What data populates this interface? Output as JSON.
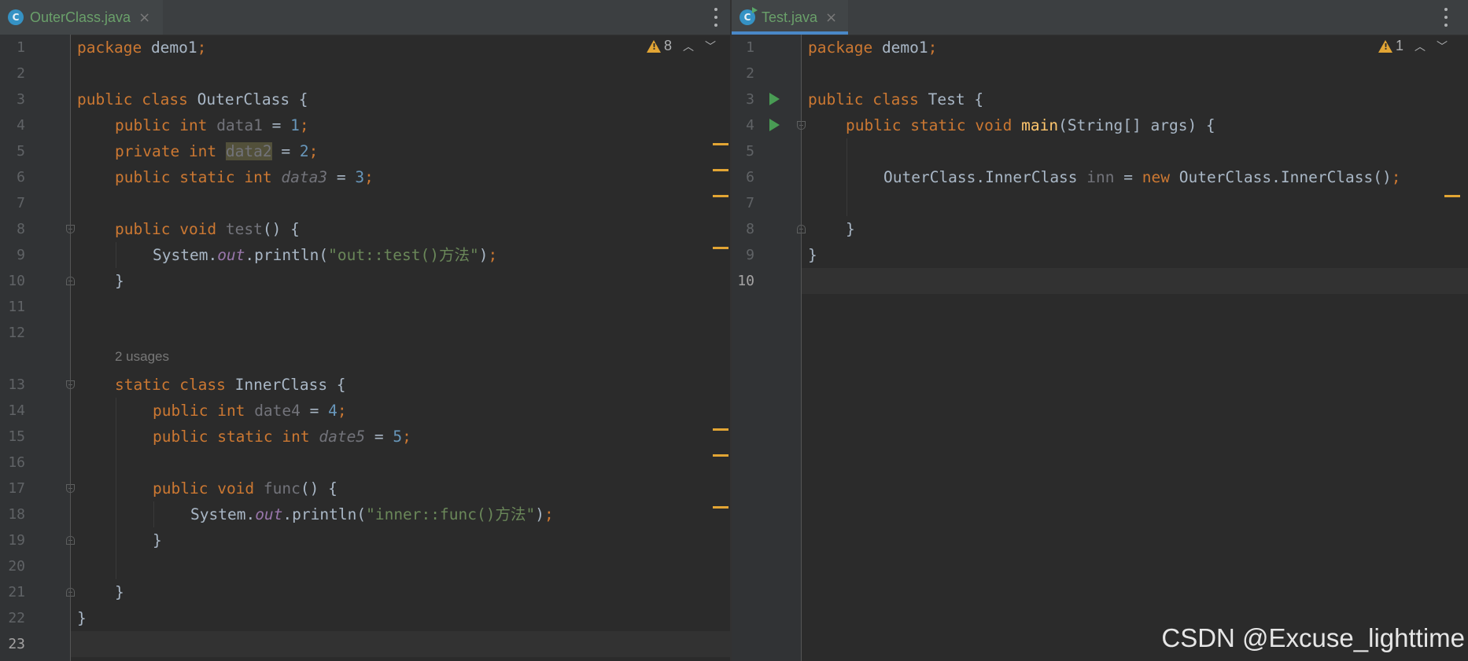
{
  "left": {
    "tab": {
      "icon": "class-icon",
      "icon_letter": "C",
      "title": "OuterClass.java",
      "close": "×"
    },
    "inspection": {
      "icon": "warning-triangle-icon",
      "count": "8"
    },
    "line_numbers": [
      "1",
      "2",
      "3",
      "4",
      "5",
      "6",
      "7",
      "8",
      "9",
      "10",
      "11",
      "12",
      "13",
      "14",
      "15",
      "16",
      "17",
      "18",
      "19",
      "20",
      "21",
      "22",
      "23"
    ],
    "inlay_hint": "2 usages",
    "code": {
      "l1": [
        "package",
        "demo1",
        ";"
      ],
      "l3": [
        "public",
        "class",
        "OuterClass {"
      ],
      "l4": [
        "public",
        "int",
        "data1",
        " = ",
        "1",
        ";"
      ],
      "l5": [
        "private",
        "int",
        "data2",
        " = ",
        "2",
        ";"
      ],
      "l6": [
        "public",
        "static",
        "int",
        "data3",
        " = ",
        "3",
        ";"
      ],
      "l8": [
        "public",
        "void",
        "test",
        "() {"
      ],
      "l9": [
        "System.",
        "out",
        ".println(",
        "\"out::test()方法\"",
        ")",
        ";"
      ],
      "l10": [
        "}"
      ],
      "l13": [
        "static",
        "class",
        "InnerClass {"
      ],
      "l14": [
        "public",
        "int",
        "date4",
        " = ",
        "4",
        ";"
      ],
      "l15": [
        "public",
        "static",
        "int",
        "date5",
        " = ",
        "5",
        ";"
      ],
      "l17": [
        "public",
        "void",
        "func",
        "() {"
      ],
      "l18": [
        "System.",
        "out",
        ".println(",
        "\"inner::func()方法\"",
        ")",
        ";"
      ],
      "l19": [
        "}"
      ],
      "l21": [
        "}"
      ],
      "l22": [
        "}"
      ]
    }
  },
  "right": {
    "tab": {
      "icon": "class-icon",
      "icon_letter": "C",
      "title": "Test.java",
      "close": "×"
    },
    "inspection": {
      "icon": "warning-triangle-icon",
      "count": "1"
    },
    "line_numbers": [
      "1",
      "2",
      "3",
      "4",
      "5",
      "6",
      "7",
      "8",
      "9",
      "10"
    ],
    "code": {
      "l1": [
        "package",
        "demo1",
        ";"
      ],
      "l3": [
        "public",
        "class",
        "Test {"
      ],
      "l4": [
        "public",
        "static",
        "void",
        "main",
        "(String[] args) {"
      ],
      "l6": [
        "OuterClass.InnerClass ",
        "inn",
        " = ",
        "new",
        " OuterClass.InnerClass()",
        ";"
      ],
      "l8": [
        "}"
      ],
      "l9": [
        "}"
      ]
    }
  },
  "watermark": "CSDN @Excuse_lighttime"
}
